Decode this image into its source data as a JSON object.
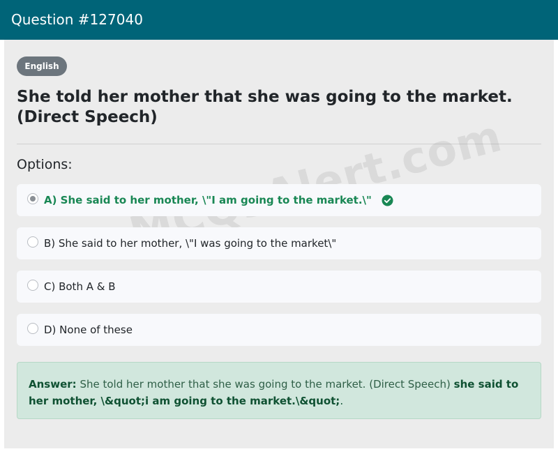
{
  "header": {
    "title": "Question #127040"
  },
  "badge": {
    "language": "English"
  },
  "question": {
    "text": "She told her mother that she was going to the market. (Direct Speech)"
  },
  "options_label": "Options:",
  "options": [
    {
      "text": "A) She said to her mother, \\\"I am going to the market.\\\"",
      "selected": true,
      "correct": true
    },
    {
      "text": "B) She said to her mother, \\\"I was going to the market\\\"",
      "selected": false,
      "correct": false
    },
    {
      "text": "C) Both A & B",
      "selected": false,
      "correct": false
    },
    {
      "text": "D) None of these",
      "selected": false,
      "correct": false
    }
  ],
  "answer": {
    "label": "Answer:",
    "question_text": "She told her mother that she was going to the market. (Direct Speech)",
    "answer_text": "she said to her mother, \\&quot;i am going to the market.\\&quot;",
    "trailing": "."
  },
  "watermark": "MCQsAlert.com",
  "colors": {
    "header_bg": "#006478",
    "correct_text": "#198754",
    "answer_bg": "#d1e7dd",
    "badge_bg": "#6c757d"
  },
  "icons": {
    "correct_option": "check-circle-icon"
  }
}
